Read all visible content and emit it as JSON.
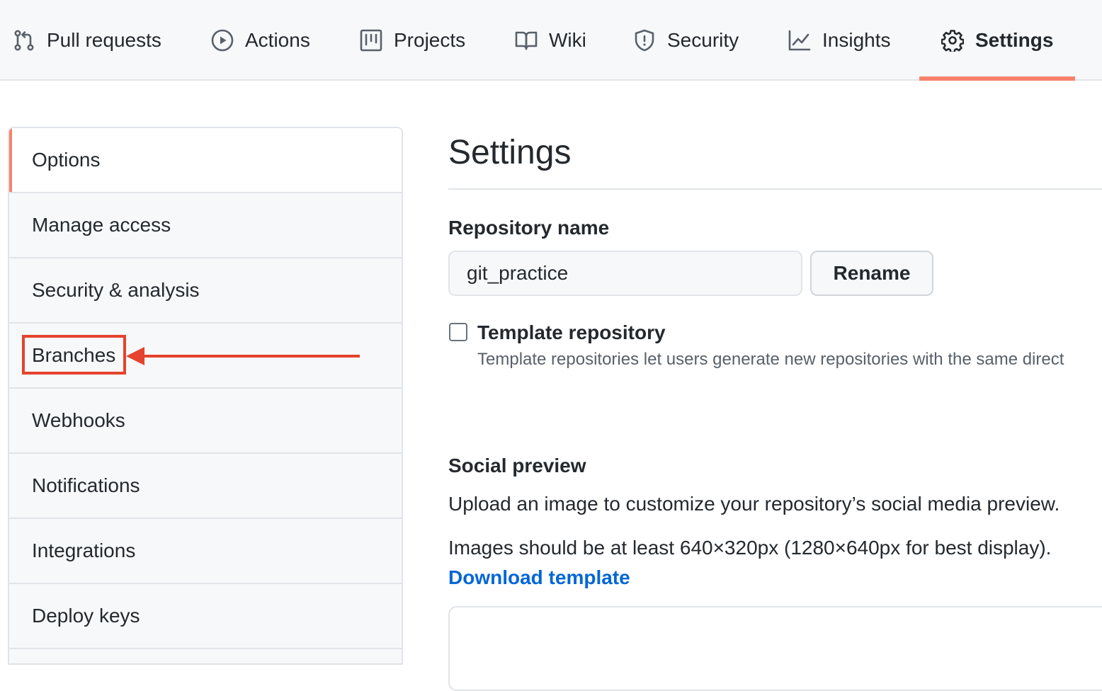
{
  "topnav": {
    "tabs": [
      {
        "label": "Pull requests",
        "icon": "pull-request-icon"
      },
      {
        "label": "Actions",
        "icon": "play-icon"
      },
      {
        "label": "Projects",
        "icon": "project-icon"
      },
      {
        "label": "Wiki",
        "icon": "book-icon"
      },
      {
        "label": "Security",
        "icon": "shield-icon"
      },
      {
        "label": "Insights",
        "icon": "graph-icon"
      },
      {
        "label": "Settings",
        "icon": "gear-icon",
        "active": true
      }
    ],
    "accent": "#f9826c"
  },
  "sidebar": {
    "items": [
      {
        "label": "Options",
        "active": true
      },
      {
        "label": "Manage access"
      },
      {
        "label": "Security & analysis"
      },
      {
        "label": "Branches",
        "highlighted": true
      },
      {
        "label": "Webhooks"
      },
      {
        "label": "Notifications"
      },
      {
        "label": "Integrations"
      },
      {
        "label": "Deploy keys"
      }
    ]
  },
  "annotation": {
    "color": "#e5432d"
  },
  "main": {
    "title": "Settings",
    "repo_name_label": "Repository name",
    "repo_name_value": "git_practice",
    "rename_label": "Rename",
    "template_label": "Template repository",
    "template_checked": false,
    "template_note": "Template repositories let users generate new repositories with the same direct",
    "social_title": "Social preview",
    "social_desc": "Upload an image to customize your repository’s social media preview.",
    "social_size_note": "Images should be at least 640×320px (1280×640px for best display).",
    "download_link": "Download template",
    "link_color": "#0366d6"
  }
}
